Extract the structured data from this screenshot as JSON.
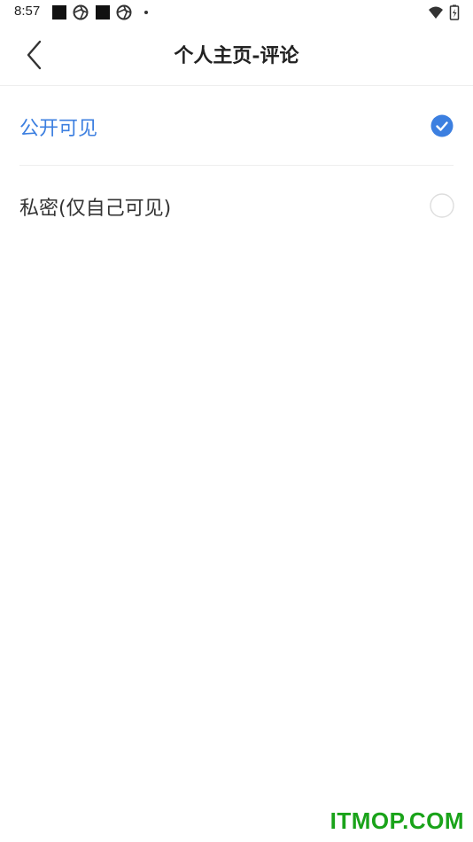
{
  "status_bar": {
    "time": "8:57"
  },
  "header": {
    "title": "个人主页-评论",
    "back_icon": "chevron-left-icon"
  },
  "options": [
    {
      "label": "公开可见",
      "selected": true
    },
    {
      "label": "私密(仅自己可见)",
      "selected": false
    }
  ],
  "colors": {
    "accent": "#3c7fe0",
    "text": "#333333",
    "divider": "#eeeeee",
    "watermark": "#1aa31a"
  },
  "watermark": "ITMOP.COM"
}
